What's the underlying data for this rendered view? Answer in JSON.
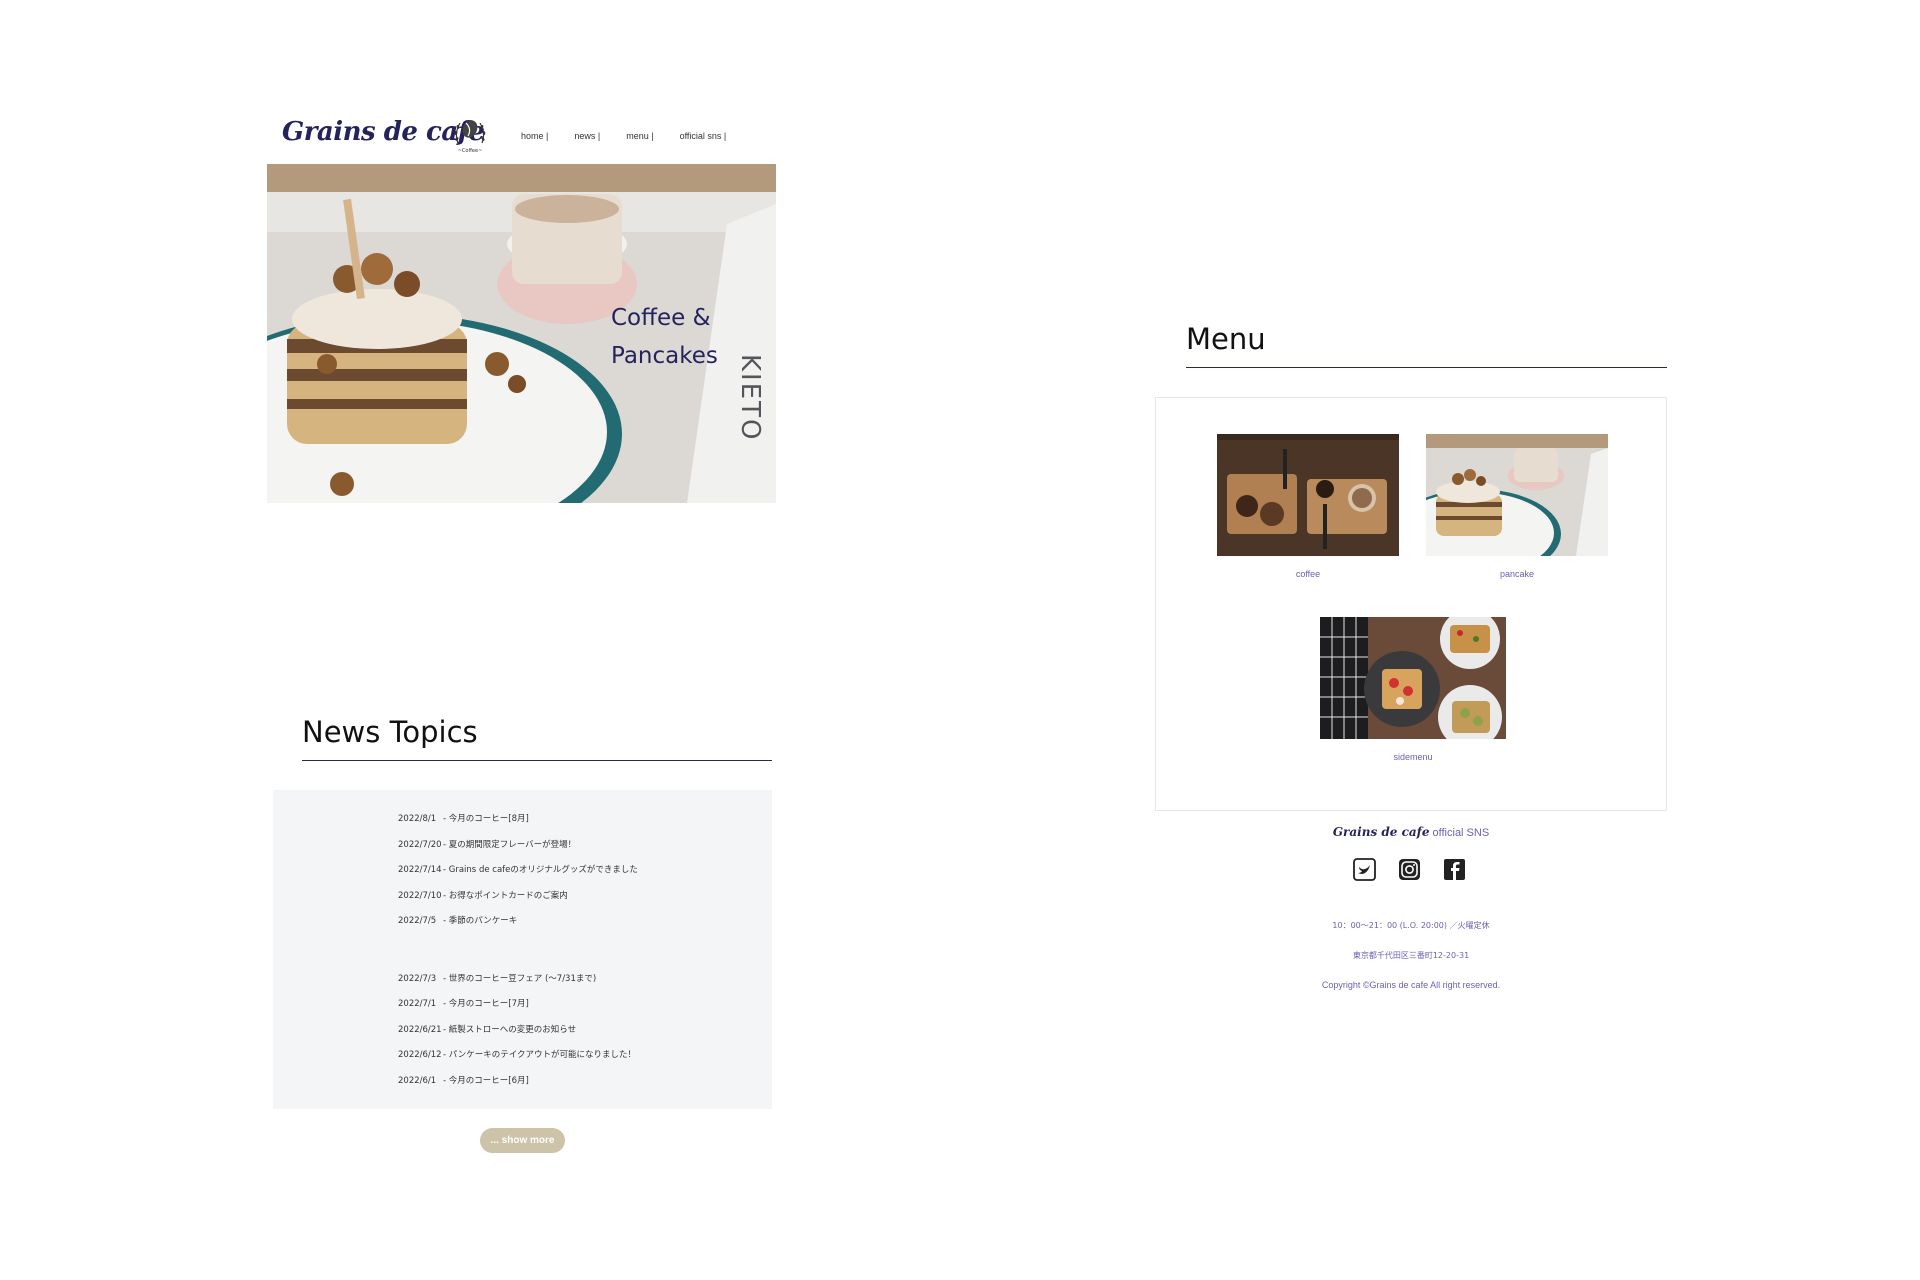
{
  "header": {
    "logo_text": "Grains de cafe",
    "badge_text": "~Coffee~",
    "nav": [
      {
        "label": "home |"
      },
      {
        "label": "news |"
      },
      {
        "label": "menu |"
      },
      {
        "label": "official sns |"
      }
    ]
  },
  "hero": {
    "caption": "Coffee &\nPancakes",
    "image": "pancake-stack-with-latte-photo"
  },
  "news": {
    "title": "News Topics",
    "items": [
      {
        "date": "2022/8/1",
        "text": "- 今月のコーヒー[8月]"
      },
      {
        "date": "2022/7/20",
        "text": "- 夏の期間限定フレーバーが登場！"
      },
      {
        "date": "2022/7/14",
        "text": "- Grains de cafeのオリジナルグッズができました"
      },
      {
        "date": "2022/7/10",
        "text": "- お得なポイントカードのご案内"
      },
      {
        "date": "2022/7/5",
        "text": "- 季節のパンケーキ"
      },
      {
        "date": "2022/7/3",
        "text": "- 世界のコーヒー豆フェア (〜7/31まで)"
      },
      {
        "date": "2022/7/1",
        "text": "- 今月のコーヒー[7月]"
      },
      {
        "date": "2022/6/21",
        "text": "- 紙製ストローへの変更のお知らせ"
      },
      {
        "date": "2022/6/12",
        "text": "- パンケーキのテイクアウトが可能になりました！"
      },
      {
        "date": "2022/6/1",
        "text": "- 今月のコーヒー[6月]"
      }
    ],
    "show_more": "... show more"
  },
  "menu": {
    "title": "Menu",
    "items": [
      {
        "caption": "coffee",
        "image": "coffee-beans-and-latte-photo"
      },
      {
        "caption": "pancake",
        "image": "pancake-photo"
      },
      {
        "caption": "sidemenu",
        "image": "toast-plates-photo"
      }
    ]
  },
  "footer": {
    "sns_brand": "Grains de cafe",
    "sns_rest": " official SNS",
    "icons": [
      "twitter-icon",
      "instagram-icon",
      "facebook-icon"
    ],
    "hours": "10：00〜21：00 (L.O. 20:00) ／火曜定休",
    "address": "東京都千代田区三番町12-20-31",
    "copyright": "Copyright ©Grains de cafe All right reserved."
  },
  "colors": {
    "brand_navy": "#25235c",
    "accent_purple": "#6f5fb0",
    "button_beige": "#cdc3a9",
    "news_bg": "#f4f5f6"
  }
}
